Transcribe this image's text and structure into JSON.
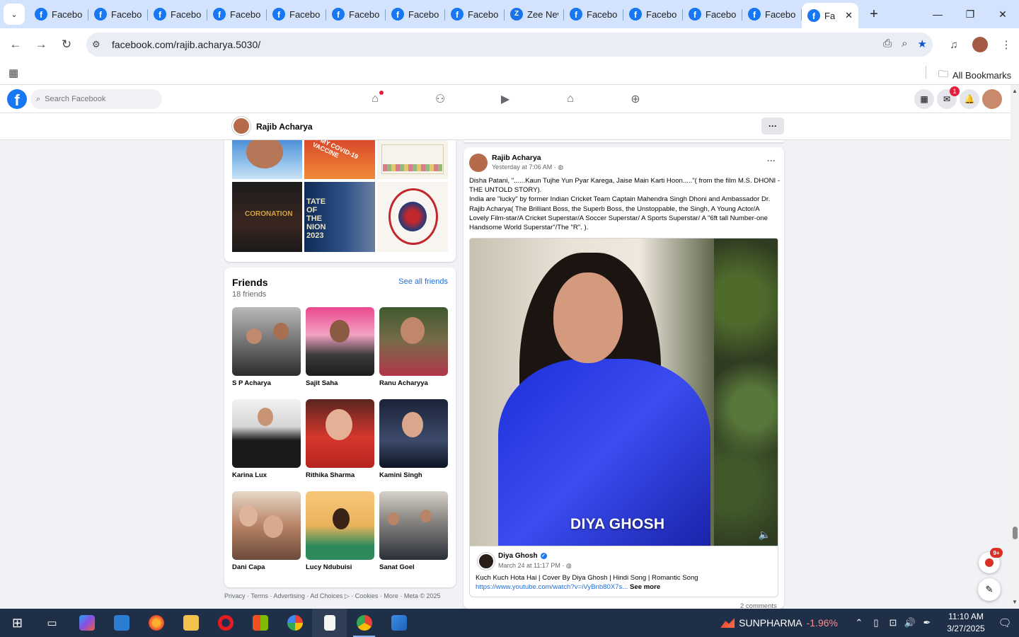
{
  "browser": {
    "tabs": [
      {
        "label": "Facebook",
        "icon": "facebook-icon"
      },
      {
        "label": "Facebook",
        "icon": "facebook-icon"
      },
      {
        "label": "Facebook",
        "icon": "facebook-icon"
      },
      {
        "label": "Facebook",
        "icon": "facebook-icon"
      },
      {
        "label": "Facebook",
        "icon": "facebook-icon"
      },
      {
        "label": "Facebook",
        "icon": "facebook-icon"
      },
      {
        "label": "Facebook",
        "icon": "facebook-icon"
      },
      {
        "label": "Facebook",
        "icon": "facebook-icon"
      },
      {
        "label": "Zee News",
        "icon": "zee-icon"
      },
      {
        "label": "Facebook",
        "icon": "facebook-icon"
      },
      {
        "label": "Facebook",
        "icon": "facebook-icon"
      },
      {
        "label": "Facebook",
        "icon": "facebook-icon"
      },
      {
        "label": "Facebook",
        "icon": "facebook-icon"
      }
    ],
    "active_tab": {
      "label": "Fa"
    },
    "url": "facebook.com/rajib.acharya.5030/",
    "bookmarks_label": "All Bookmarks"
  },
  "facebook": {
    "search_placeholder": "Search Facebook",
    "messenger_badge": "1",
    "profile_name": "Rajib Acharya",
    "photos": {
      "overlay_vaccine": "T MY COVID-19 VACCINE",
      "overlay_coronation": "CORONATION",
      "overlay_state": "TATE OF THE NION 2023"
    },
    "friends": {
      "title": "Friends",
      "count": "18 friends",
      "see_all": "See all friends",
      "list": [
        "S P Acharya",
        "Sajit Saha",
        "Ranu Acharyya",
        "Karina Lux",
        "Rithika Sharma",
        "Kamini Singh",
        "Dani Capa",
        "Lucy Ndubuisi",
        "Sanat Goel"
      ]
    },
    "footer": "Privacy · Terms · Advertising · Ad Choices ▷ · Cookies · More · Meta © 2025",
    "post": {
      "author": "Rajib Acharya",
      "time": "Yesterday at 7:06 AM · ◍",
      "text_1": "Disha Patani, \"......Kaun Tujhe Yun Pyar Karega, Jaise Main Karti Hoon.....\"( from the film M.S. DHONI -THE UNTOLD STORY).",
      "text_2": " India are \"lucky\" by former Indian Cricket Team Captain Mahendra Singh Dhoni and Ambassador Dr. Rajib Acharya( The Brilliant Boss, the Superb Boss, the Unstoppable, the Singh, A Young Actor/A Lovely Film-star/A Cricket Superstar/A Soccer Superstar/ A Sports Superstar/ A \"6ft tall Number-one Handsome World Superstar\"/The \"R\". ).",
      "media_caption": "DIYA GHOSH",
      "shared": {
        "name": "Diya Ghosh",
        "time": "March 24 at 11:17 PM · ◍",
        "text": "Kuch Kuch Hota Hai | Cover By Diya Ghosh | Hindi Song | Romantic Song",
        "link": "https://www.youtube.com/watch?v=iVyBnb80X7s...",
        "see_more": "See more"
      },
      "comments": "2 comments"
    },
    "news_badge": "9+"
  },
  "taskbar": {
    "stock_name": "SUNPHARMA",
    "stock_change": "-1.96%",
    "time": "11:10 AM",
    "date": "3/27/2025"
  }
}
